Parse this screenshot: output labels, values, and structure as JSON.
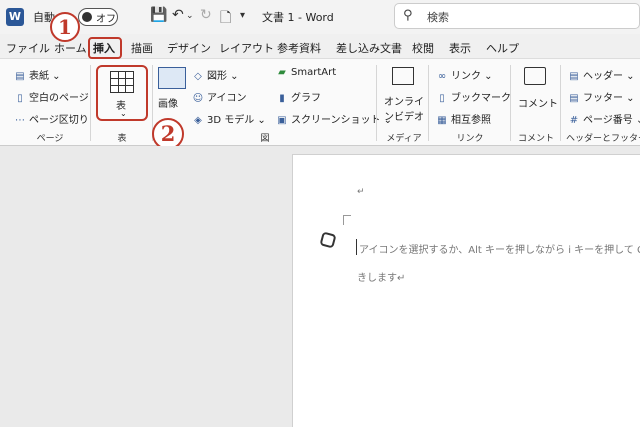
{
  "titlebar": {
    "app_logo": "W",
    "autosave_label": "自動",
    "toggle_text": "オフ",
    "doc_title": "文書 1 - Word",
    "search_placeholder": "検索"
  },
  "tabs": [
    "ファイル",
    "ホーム",
    "挿入",
    "描画",
    "デザイン",
    "レイアウト",
    "参考資料",
    "差し込み文書",
    "校閲",
    "表示",
    "ヘルプ"
  ],
  "active_tab": "挿入",
  "ribbon": {
    "pages": {
      "items": [
        "表紙",
        "空白のページ",
        "ページ区切り"
      ],
      "label": "ページ"
    },
    "table": {
      "button": "表",
      "label": "表"
    },
    "illustrations": {
      "image": "画像",
      "shapes": "図形",
      "icons": "アイコン",
      "model3d": "3D モデル",
      "smartart": "SmartArt",
      "graph": "グラフ",
      "screenshot": "スクリーンショット",
      "label": "図"
    },
    "media": {
      "button_line1": "オンライ",
      "button_line2": "ンビデオ",
      "label": "メディア"
    },
    "links": {
      "items": [
        "リンク",
        "ブックマーク",
        "相互参照"
      ],
      "label": "リンク"
    },
    "comments": {
      "button": "コメント",
      "label": "コメント"
    },
    "header_footer": {
      "items": [
        "ヘッダー",
        "フッター",
        "ページ番号"
      ],
      "label": "ヘッダーとフッター"
    }
  },
  "annotations": {
    "step1": "1",
    "step2": "2"
  },
  "document": {
    "para_mark": "↵",
    "hint_line1": "アイコンを選択するか、Alt キーを押しながら i キーを押して Copi",
    "hint_line2": "きします↵"
  },
  "colors": {
    "annotation": "#c0392b",
    "word_blue": "#2b5797"
  }
}
